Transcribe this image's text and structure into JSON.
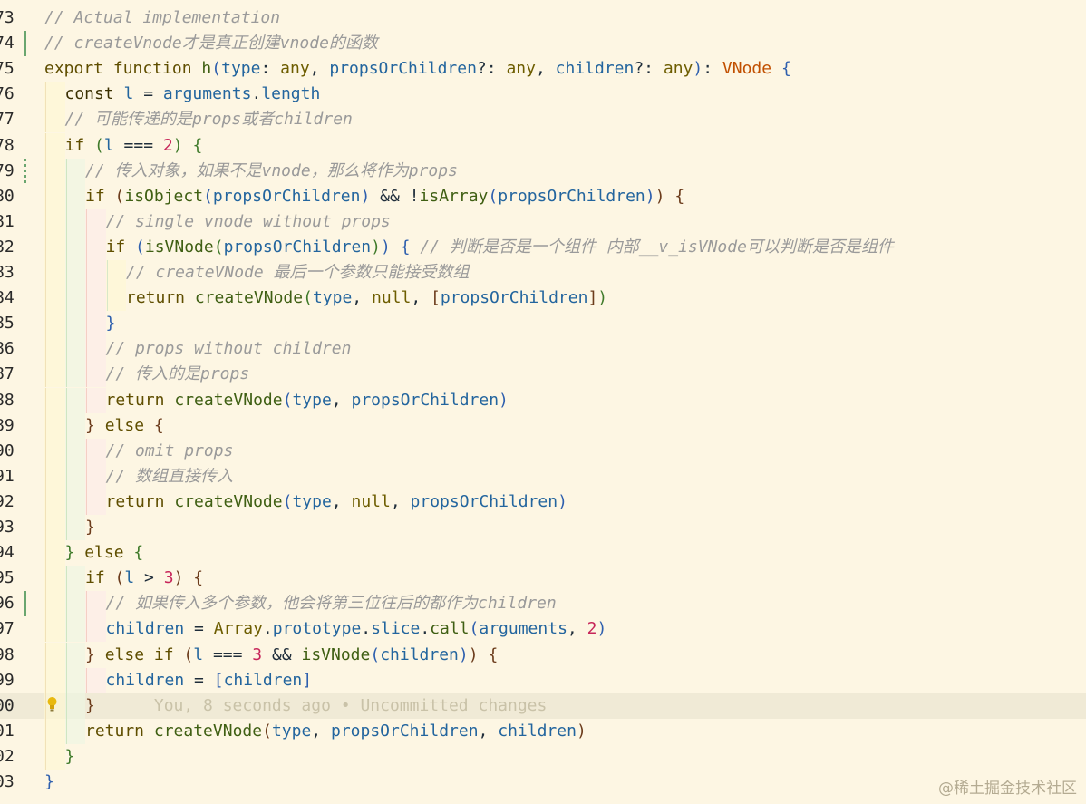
{
  "editor": {
    "lines": [
      {
        "n": "73",
        "tokens": [
          [
            "cm",
            "// Actual implementation"
          ]
        ]
      },
      {
        "n": "74",
        "tokens": [
          [
            "cm",
            "// createVnode才是真正创建vnode的函数"
          ]
        ]
      },
      {
        "n": "75",
        "tokens": [
          [
            "kw",
            "export"
          ],
          [
            "op",
            " "
          ],
          [
            "kw",
            "function"
          ],
          [
            "op",
            " "
          ],
          [
            "fn",
            "h"
          ],
          [
            "b1",
            "("
          ],
          [
            "id",
            "type"
          ],
          [
            "op",
            ": "
          ],
          [
            "ty",
            "any"
          ],
          [
            "op",
            ", "
          ],
          [
            "id",
            "propsOrChildren"
          ],
          [
            "op",
            "?: "
          ],
          [
            "ty",
            "any"
          ],
          [
            "op",
            ", "
          ],
          [
            "id",
            "children"
          ],
          [
            "op",
            "?: "
          ],
          [
            "ty",
            "any"
          ],
          [
            "b1",
            ")"
          ],
          [
            "op",
            ": "
          ],
          [
            "tyr",
            "VNode"
          ],
          [
            "op",
            " "
          ],
          [
            "b1",
            "{"
          ]
        ]
      },
      {
        "n": "76",
        "tokens": [
          [
            "kwb",
            "const"
          ],
          [
            "op",
            " "
          ],
          [
            "id",
            "l"
          ],
          [
            "op",
            " = "
          ],
          [
            "id",
            "arguments"
          ],
          [
            "op",
            "."
          ],
          [
            "id",
            "length"
          ]
        ]
      },
      {
        "n": "77",
        "tokens": [
          [
            "cm",
            "// 可能传递的是props或者children"
          ]
        ]
      },
      {
        "n": "78",
        "tokens": [
          [
            "kw",
            "if"
          ],
          [
            "op",
            " "
          ],
          [
            "b2",
            "("
          ],
          [
            "id",
            "l"
          ],
          [
            "op",
            " === "
          ],
          [
            "num",
            "2"
          ],
          [
            "b2",
            ")"
          ],
          [
            "op",
            " "
          ],
          [
            "b2",
            "{"
          ]
        ]
      },
      {
        "n": "79",
        "tokens": [
          [
            "cm",
            "// 传入对象，如果不是vnode，那么将作为props"
          ]
        ]
      },
      {
        "n": "80",
        "tokens": [
          [
            "kw",
            "if"
          ],
          [
            "op",
            " "
          ],
          [
            "b3",
            "("
          ],
          [
            "fn",
            "isObject"
          ],
          [
            "b1",
            "("
          ],
          [
            "id",
            "propsOrChildren"
          ],
          [
            "b1",
            ")"
          ],
          [
            "op",
            " && !"
          ],
          [
            "fn",
            "isArray"
          ],
          [
            "b1",
            "("
          ],
          [
            "id",
            "propsOrChildren"
          ],
          [
            "b1",
            ")"
          ],
          [
            "b3",
            ")"
          ],
          [
            "op",
            " "
          ],
          [
            "b3",
            "{"
          ]
        ]
      },
      {
        "n": "81",
        "tokens": [
          [
            "cm",
            "// single vnode without props"
          ]
        ]
      },
      {
        "n": "82",
        "tokens": [
          [
            "kw",
            "if"
          ],
          [
            "op",
            " "
          ],
          [
            "b1",
            "("
          ],
          [
            "fn",
            "isVNode"
          ],
          [
            "b2",
            "("
          ],
          [
            "id",
            "propsOrChildren"
          ],
          [
            "b2",
            ")"
          ],
          [
            "b1",
            ")"
          ],
          [
            "op",
            " "
          ],
          [
            "b1",
            "{"
          ],
          [
            "op",
            " "
          ],
          [
            "cm",
            "// 判断是否是一个组件 内部__v_isVNode可以判断是否是组件"
          ]
        ]
      },
      {
        "n": "83",
        "tokens": [
          [
            "cm",
            "// createVNode 最后一个参数只能接受数组"
          ]
        ]
      },
      {
        "n": "84",
        "tokens": [
          [
            "kw",
            "return"
          ],
          [
            "op",
            " "
          ],
          [
            "fn",
            "createVNode"
          ],
          [
            "b2",
            "("
          ],
          [
            "id",
            "type"
          ],
          [
            "op",
            ", "
          ],
          [
            "ty",
            "null"
          ],
          [
            "op",
            ", "
          ],
          [
            "b3",
            "["
          ],
          [
            "id",
            "propsOrChildren"
          ],
          [
            "b3",
            "]"
          ],
          [
            "b2",
            ")"
          ]
        ]
      },
      {
        "n": "85",
        "tokens": [
          [
            "b1",
            "}"
          ]
        ]
      },
      {
        "n": "86",
        "tokens": [
          [
            "cm",
            "// props without children"
          ]
        ]
      },
      {
        "n": "87",
        "tokens": [
          [
            "cm",
            "// 传入的是props"
          ]
        ]
      },
      {
        "n": "88",
        "tokens": [
          [
            "kw",
            "return"
          ],
          [
            "op",
            " "
          ],
          [
            "fn",
            "createVNode"
          ],
          [
            "b1",
            "("
          ],
          [
            "id",
            "type"
          ],
          [
            "op",
            ", "
          ],
          [
            "id",
            "propsOrChildren"
          ],
          [
            "b1",
            ")"
          ]
        ]
      },
      {
        "n": "89",
        "tokens": [
          [
            "b3",
            "}"
          ],
          [
            "op",
            " "
          ],
          [
            "kw",
            "else"
          ],
          [
            "op",
            " "
          ],
          [
            "b3",
            "{"
          ]
        ]
      },
      {
        "n": "90",
        "tokens": [
          [
            "cm",
            "// omit props"
          ]
        ]
      },
      {
        "n": "91",
        "tokens": [
          [
            "cm",
            "// 数组直接传入"
          ]
        ]
      },
      {
        "n": "92",
        "tokens": [
          [
            "kw",
            "return"
          ],
          [
            "op",
            " "
          ],
          [
            "fn",
            "createVNode"
          ],
          [
            "b1",
            "("
          ],
          [
            "id",
            "type"
          ],
          [
            "op",
            ", "
          ],
          [
            "ty",
            "null"
          ],
          [
            "op",
            ", "
          ],
          [
            "id",
            "propsOrChildren"
          ],
          [
            "b1",
            ")"
          ]
        ]
      },
      {
        "n": "93",
        "tokens": [
          [
            "b3",
            "}"
          ]
        ]
      },
      {
        "n": "94",
        "tokens": [
          [
            "b2",
            "}"
          ],
          [
            "op",
            " "
          ],
          [
            "kw",
            "else"
          ],
          [
            "op",
            " "
          ],
          [
            "b2",
            "{"
          ]
        ]
      },
      {
        "n": "95",
        "tokens": [
          [
            "kw",
            "if"
          ],
          [
            "op",
            " "
          ],
          [
            "b3",
            "("
          ],
          [
            "id",
            "l"
          ],
          [
            "op",
            " > "
          ],
          [
            "num",
            "3"
          ],
          [
            "b3",
            ")"
          ],
          [
            "op",
            " "
          ],
          [
            "b3",
            "{"
          ]
        ]
      },
      {
        "n": "96",
        "tokens": [
          [
            "cm",
            "// 如果传入多个参数，他会将第三位往后的都作为children"
          ]
        ]
      },
      {
        "n": "97",
        "tokens": [
          [
            "id",
            "children"
          ],
          [
            "op",
            " = "
          ],
          [
            "ty",
            "Array"
          ],
          [
            "op",
            "."
          ],
          [
            "id",
            "prototype"
          ],
          [
            "op",
            "."
          ],
          [
            "id",
            "slice"
          ],
          [
            "op",
            "."
          ],
          [
            "fn",
            "call"
          ],
          [
            "b1",
            "("
          ],
          [
            "id",
            "arguments"
          ],
          [
            "op",
            ", "
          ],
          [
            "num",
            "2"
          ],
          [
            "b1",
            ")"
          ]
        ]
      },
      {
        "n": "98",
        "tokens": [
          [
            "b3",
            "}"
          ],
          [
            "op",
            " "
          ],
          [
            "kw",
            "else"
          ],
          [
            "op",
            " "
          ],
          [
            "kw",
            "if"
          ],
          [
            "op",
            " "
          ],
          [
            "b3",
            "("
          ],
          [
            "id",
            "l"
          ],
          [
            "op",
            " === "
          ],
          [
            "num",
            "3"
          ],
          [
            "op",
            " && "
          ],
          [
            "fn",
            "isVNode"
          ],
          [
            "b1",
            "("
          ],
          [
            "id",
            "children"
          ],
          [
            "b1",
            ")"
          ],
          [
            "b3",
            ")"
          ],
          [
            "op",
            " "
          ],
          [
            "b3",
            "{"
          ]
        ]
      },
      {
        "n": "99",
        "tokens": [
          [
            "id",
            "children"
          ],
          [
            "op",
            " = "
          ],
          [
            "b1",
            "["
          ],
          [
            "id",
            "children"
          ],
          [
            "b1",
            "]"
          ]
        ]
      },
      {
        "n": "00",
        "tokens": [
          [
            "b3",
            "}"
          ]
        ],
        "blame": "You, 8 seconds ago • Uncommitted changes"
      },
      {
        "n": "01",
        "tokens": [
          [
            "kw",
            "return"
          ],
          [
            "op",
            " "
          ],
          [
            "fn",
            "createVNode"
          ],
          [
            "b3",
            "("
          ],
          [
            "id",
            "type"
          ],
          [
            "op",
            ", "
          ],
          [
            "id",
            "propsOrChildren"
          ],
          [
            "op",
            ", "
          ],
          [
            "id",
            "children"
          ],
          [
            "b3",
            ")"
          ]
        ]
      },
      {
        "n": "02",
        "tokens": [
          [
            "b2",
            "}"
          ]
        ]
      },
      {
        "n": "03",
        "tokens": [
          [
            "b1",
            "}"
          ]
        ]
      }
    ]
  },
  "watermark": "@稀土掘金技术社区"
}
